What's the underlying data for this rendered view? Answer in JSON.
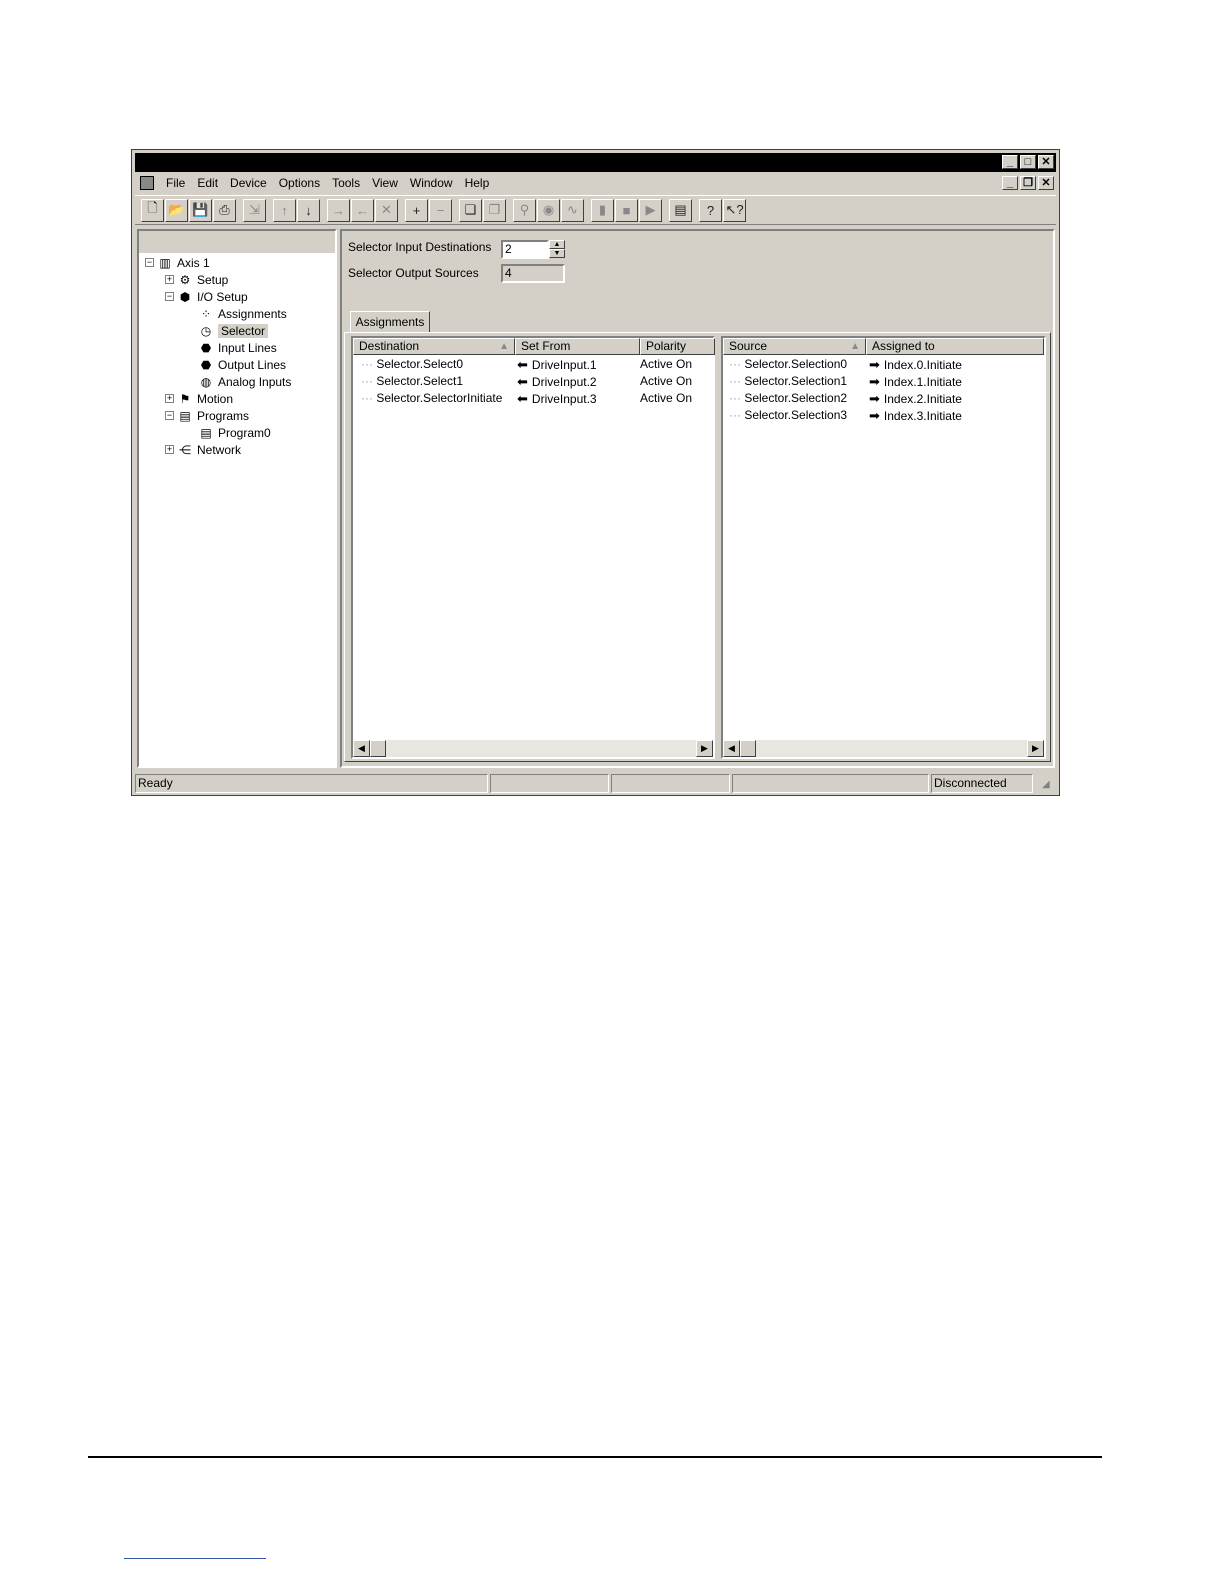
{
  "window": {
    "title": "",
    "min": "_",
    "max": "□",
    "close": "✕"
  },
  "menu": [
    "File",
    "Edit",
    "Device",
    "Options",
    "Tools",
    "View",
    "Window",
    "Help"
  ],
  "tree": {
    "items": [
      {
        "label": "Axis 1",
        "icon": "drive-icon"
      },
      {
        "label": "Setup",
        "icon": "setup-icon"
      },
      {
        "label": "I/O Setup",
        "icon": "io-setup-icon"
      },
      {
        "label": "Assignments",
        "icon": "assignments-icon"
      },
      {
        "label": "Selector",
        "icon": "selector-icon"
      },
      {
        "label": "Input Lines",
        "icon": "input-lines-icon"
      },
      {
        "label": "Output Lines",
        "icon": "output-lines-icon"
      },
      {
        "label": "Analog Inputs",
        "icon": "analog-inputs-icon"
      },
      {
        "label": "Motion",
        "icon": "motion-icon"
      },
      {
        "label": "Programs",
        "icon": "programs-icon"
      },
      {
        "label": "Program0",
        "icon": "program-icon"
      },
      {
        "label": "Network",
        "icon": "network-icon"
      }
    ]
  },
  "fields": {
    "input_destinations_label": "Selector Input Destinations",
    "input_destinations_value": "2",
    "output_sources_label": "Selector Output Sources",
    "output_sources_value": "4"
  },
  "tab": "Assignments",
  "left_table": {
    "headers": [
      "Destination",
      "Set From",
      "Polarity"
    ],
    "rows": [
      [
        "Selector.Select0",
        "DriveInput.1",
        "Active On"
      ],
      [
        "Selector.Select1",
        "DriveInput.2",
        "Active On"
      ],
      [
        "Selector.SelectorInitiate",
        "DriveInput.3",
        "Active On"
      ]
    ]
  },
  "right_table": {
    "headers": [
      "Source",
      "Assigned to"
    ],
    "rows": [
      [
        "Selector.Selection0",
        "Index.0.Initiate"
      ],
      [
        "Selector.Selection1",
        "Index.1.Initiate"
      ],
      [
        "Selector.Selection2",
        "Index.2.Initiate"
      ],
      [
        "Selector.Selection3",
        "Index.3.Initiate"
      ]
    ]
  },
  "status": {
    "left": "Ready",
    "right": "Disconnected"
  }
}
